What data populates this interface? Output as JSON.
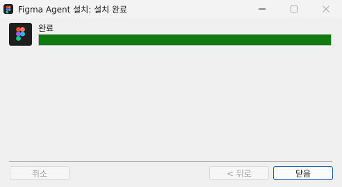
{
  "window": {
    "title": "Figma Agent 설치: 설치 완료"
  },
  "app": {
    "icon": "figma-logo-icon"
  },
  "install": {
    "status_label": "완료",
    "progress_percent": 100
  },
  "buttons": {
    "cancel_label": "취소",
    "back_label": "< 뒤로",
    "close_label": "닫음"
  },
  "colors": {
    "progress": "#107c10",
    "focus_border": "#1f5fb0"
  }
}
